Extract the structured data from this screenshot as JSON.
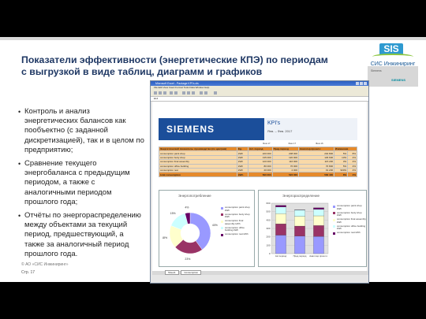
{
  "slide": {
    "title_line1": "Показатели эффективности (энергетические КПЭ) по периодам",
    "title_line2": "с выгрузкой в виде таблиц, диаграмм и графиков",
    "bullets": [
      "Контроль и анализ энергетических балансов как пообъектно (с заданной дискретизацией), так и в целом по предприятию;",
      "Сравнение текущего энергобаланса с предыдущим периодом, а также с аналогичными периодом прошлого года;",
      "Отчёты по энергораспределению между объектами за текущий период, предшествующий, а также за аналогичный период прошлого года."
    ],
    "footer_copyright": "© АО «СИС Инжиниринг»",
    "footer_page": "Стр. 17"
  },
  "logo": {
    "brand": "SIS",
    "company": "СИС Инжиниринг",
    "side_caption": "Siemens",
    "side_brand": "SIEMENS",
    "accent": "#2e9ad0",
    "swoosh": "#8cc63f"
  },
  "window": {
    "title": "Microsoft Excel - Package KPI's.xls",
    "menu": "File  Edit  View  Insert  Format  Tools  Data  Window  Help",
    "cell_ref": "E14",
    "tabs": [
      "Sheet1",
      "Consumption"
    ]
  },
  "report": {
    "brand": "SIEMENS",
    "kpi_label": "KPI's",
    "period": "Янв. – Фев. 2017",
    "col_months": [
      "Янв.17",
      "Фев.17",
      "Фев.16"
    ],
    "headers": [
      "Энергетический показатель: производство (по центрам)",
      "Ед.",
      "Акт. период",
      "Пред.период",
      "Анал.пер.прошл.г.",
      "Изменение"
    ],
    "rows": [
      [
        "consumption paint shop",
        "kWh",
        "220 000",
        "208 000",
        "204 800",
        "5%",
        "8%"
      ],
      [
        "consumption body shop",
        "kWh",
        "135 000",
        "120 000",
        "129 600",
        "13%",
        "4%"
      ],
      [
        "consumption final assembly",
        "kWh",
        "120 000",
        "116 000",
        "115 200",
        "3%",
        "4%"
      ],
      [
        "consumption office building",
        "kWh",
        "80 000",
        "76 000",
        "76 800",
        "5%",
        "4%"
      ],
      [
        "consumption rest",
        "kWh",
        "20 000",
        "2 000",
        "19 200",
        "900%",
        "4%"
      ],
      [
        "total consumption",
        "kWh",
        "590 000",
        "522 000",
        "566 400",
        "8%",
        "4%"
      ]
    ]
  },
  "pie": {
    "title": "Энергопотребление",
    "labels_pct": [
      "40%",
      "23%",
      "18%",
      "15%",
      "4%"
    ],
    "legend": [
      "consumption paint shop kWh",
      "consumption body shop kWh",
      "consumption final assembly kWh",
      "consumption office building kWh",
      "consumption rest kWh"
    ]
  },
  "bars": {
    "title": "Энергораспределение",
    "yticks": [
      "600",
      "500",
      "400",
      "300",
      "200",
      "100",
      "0"
    ],
    "x_labels": [
      "Акт.период",
      "Пред.период",
      "Анал.пер.прошл.г."
    ],
    "legend": [
      "consumption paint shop kWh",
      "consumption body shop kWh",
      "consumption final assembly kWh",
      "consumption office building kWh",
      "consumption rest kWh"
    ]
  },
  "colors": {
    "series": [
      "#9999ff",
      "#993366",
      "#ffffcc",
      "#ccffff",
      "#660066"
    ],
    "table_header": "#e58a2c",
    "table_row": "#f9d9a8",
    "title": "#1f3864"
  },
  "chart_data": [
    {
      "type": "pie",
      "title": "Энергопотребление",
      "categories": [
        "consumption paint shop kWh",
        "consumption body shop kWh",
        "consumption final assembly kWh",
        "consumption office building kWh",
        "consumption rest kWh"
      ],
      "values": [
        40,
        23,
        18,
        15,
        4
      ]
    },
    {
      "type": "bar",
      "stacked": true,
      "title": "Энергораспределение",
      "categories": [
        "Акт.период",
        "Пред.период",
        "Анал.пер.прошл.г."
      ],
      "ylim": [
        0,
        600
      ],
      "series": [
        {
          "name": "consumption paint shop kWh",
          "values": [
            220,
            208,
            205
          ]
        },
        {
          "name": "consumption body shop kWh",
          "values": [
            135,
            120,
            130
          ]
        },
        {
          "name": "consumption final assembly kWh",
          "values": [
            120,
            116,
            115
          ]
        },
        {
          "name": "consumption office building kWh",
          "values": [
            80,
            76,
            77
          ]
        },
        {
          "name": "consumption rest kWh",
          "values": [
            20,
            2,
            19
          ]
        }
      ]
    }
  ]
}
